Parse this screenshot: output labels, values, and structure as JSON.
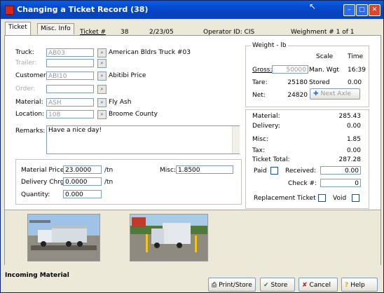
{
  "window": {
    "title": "Changing a Ticket Record  (38)"
  },
  "tabs": [
    {
      "label": "Ticket"
    },
    {
      "label": "Misc. Info"
    }
  ],
  "header": {
    "ticket_label": "Ticket #",
    "ticket_number": "38",
    "date": "2/23/05",
    "operator": "Operator ID: CIS",
    "weighment": "Weighment # 1  of 1"
  },
  "fields": {
    "truck": {
      "label": "Truck:",
      "value": "AB03",
      "desc": "American Bldrs Truck #03"
    },
    "trailer": {
      "label": "Trailer:",
      "value": ""
    },
    "customer": {
      "label": "Customer:",
      "value": "ABI10",
      "desc": "Abitibi Price"
    },
    "order": {
      "label": "Order:",
      "value": ""
    },
    "material": {
      "label": "Material:",
      "value": "ASH",
      "desc": "Fly Ash"
    },
    "location": {
      "label": "Location:",
      "value": "108",
      "desc": "Broome County"
    },
    "remarks": {
      "label": "Remarks:",
      "value": "Have a nice day!"
    }
  },
  "pricing": {
    "material_price_label": "Material Price",
    "material_price": "23.0000",
    "material_unit": "/tn",
    "delivery_label": "Delivery Chrg:",
    "delivery": "0.0000",
    "delivery_unit": "/tn",
    "quantity_label": "Quantity:",
    "quantity": "0.000",
    "misc_label": "Misc:",
    "misc": "1.8500"
  },
  "weight": {
    "group_title": "Weight - lb",
    "scale_header": "Scale",
    "time_header": "Time",
    "gross_label": "Gross:",
    "gross": "50000",
    "gross_scale": "Man. Wgt",
    "gross_time": "16:39",
    "tare_label": "Tare:",
    "tare": "25180",
    "tare_scale": "Stored",
    "tare_time": "0.00",
    "net_label": "Net:",
    "net": "24820",
    "next_axle_label": "Next Axle"
  },
  "totals": {
    "material_label": "Material:",
    "material": "285.43",
    "delivery_label": "Delivery:",
    "delivery": "0.00",
    "misc_label": "Misc:",
    "misc": "1.85",
    "tax_label": "Tax:",
    "tax": "0.00",
    "total_label": "Ticket Total:",
    "total": "287.28",
    "paid_label": "Paid",
    "received_label": "Received:",
    "received": "0.00",
    "check_label": "Check #:",
    "check": "0",
    "replacement_label": "Replacement Ticket",
    "void_label": "Void"
  },
  "status": {
    "text": "Incoming Material"
  },
  "buttons": {
    "print_store": "Print/Store",
    "store": "Store",
    "cancel": "Cancel",
    "help": "Help"
  },
  "colors": {
    "title_bar": "#0548c9",
    "page_bg": "#ffffff",
    "chrome": "#ece9d8"
  }
}
